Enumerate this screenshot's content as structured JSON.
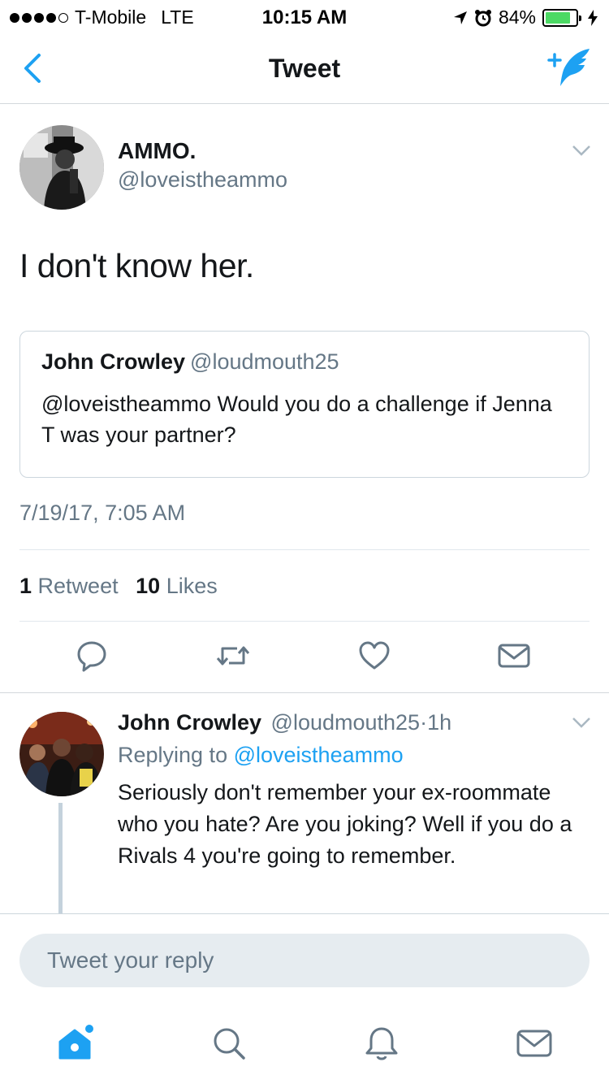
{
  "status_bar": {
    "carrier": "T-Mobile",
    "network": "LTE",
    "time": "10:15 AM",
    "battery_percent": "84%",
    "battery_level": 0.84,
    "signal_bars": 4,
    "battery_color": "#4cd964"
  },
  "nav": {
    "title": "Tweet",
    "back_icon": "chevron-left-icon",
    "compose_icon": "compose-tweet-icon",
    "accent_color": "#1da1f2"
  },
  "tweet": {
    "author_name": "AMMO.",
    "author_handle": "@loveistheammo",
    "text": "I don't know her.",
    "quote": {
      "author_name": "John Crowley",
      "author_handle": "@loudmouth25",
      "text": "@loveistheammo Would you do a challenge if Jenna T was your partner?"
    },
    "timestamp": "7/19/17, 7:05 AM",
    "stats": {
      "retweet_count": "1",
      "retweet_label": "Retweet",
      "like_count": "10",
      "like_label": "Likes"
    },
    "actions": [
      "reply-icon",
      "retweet-icon",
      "like-icon",
      "message-icon"
    ]
  },
  "reply": {
    "author_name": "John Crowley",
    "author_handle": "@loudmouth25",
    "separator": "·",
    "time_ago": "1h",
    "replying_prefix": "Replying to",
    "replying_handle": "@loveistheammo",
    "text": "Seriously don't remember your ex-roommate who you hate? Are you joking? Well if you do a Rivals 4 you're going to remember."
  },
  "compose": {
    "placeholder": "Tweet your reply"
  },
  "tabbar": {
    "tabs": [
      "home-icon",
      "search-icon",
      "notifications-icon",
      "messages-icon"
    ],
    "active_tab": "home-icon"
  }
}
